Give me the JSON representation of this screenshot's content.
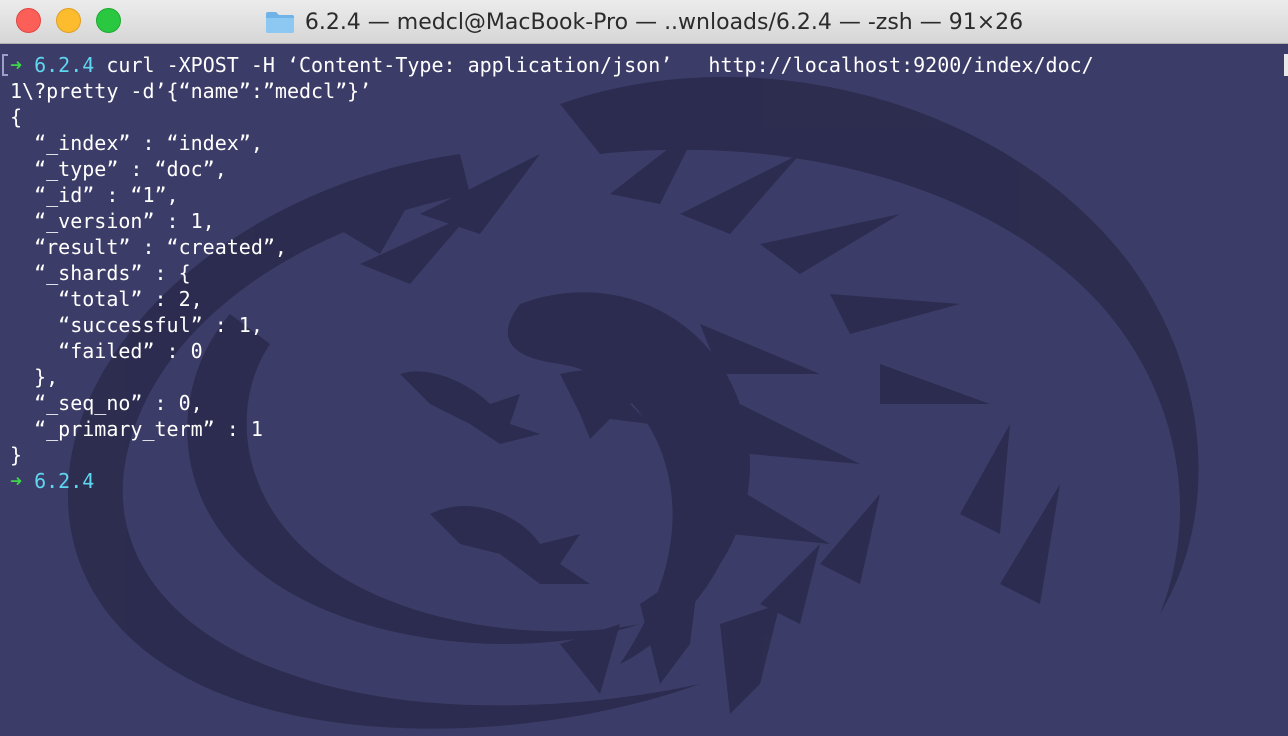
{
  "window": {
    "title": "6.2.4 — medcl@MacBook-Pro — ..wnloads/6.2.4 — -zsh — 91×26"
  },
  "colors": {
    "background": "#3c3c68",
    "text": "#ffffff",
    "prompt_arrow": "#3ed64a",
    "prompt_dir": "#5fd7f0"
  },
  "terminal": {
    "prompt_arrow": "➜",
    "prompt_dir": "6.2.4",
    "command_line_1": "curl -XPOST -H ‘Content-Type: application/json’   http://localhost:9200/index/doc/",
    "command_line_2": "1\\?pretty -d’{“name”:”medcl”}’",
    "output": [
      "{",
      "  “_index” : “index”,",
      "  “_type” : “doc”,",
      "  “_id” : “1”,",
      "  “_version” : 1,",
      "  “result” : “created”,",
      "  “_shards” : {",
      "    “total” : 2,",
      "    “successful” : 1,",
      "    “failed” : 0",
      "  },",
      "  “_seq_no” : 0,",
      "  “_primary_term” : 1",
      "}"
    ]
  },
  "icons": {
    "title_folder": "folder-icon",
    "background_art": "dragon-background"
  }
}
